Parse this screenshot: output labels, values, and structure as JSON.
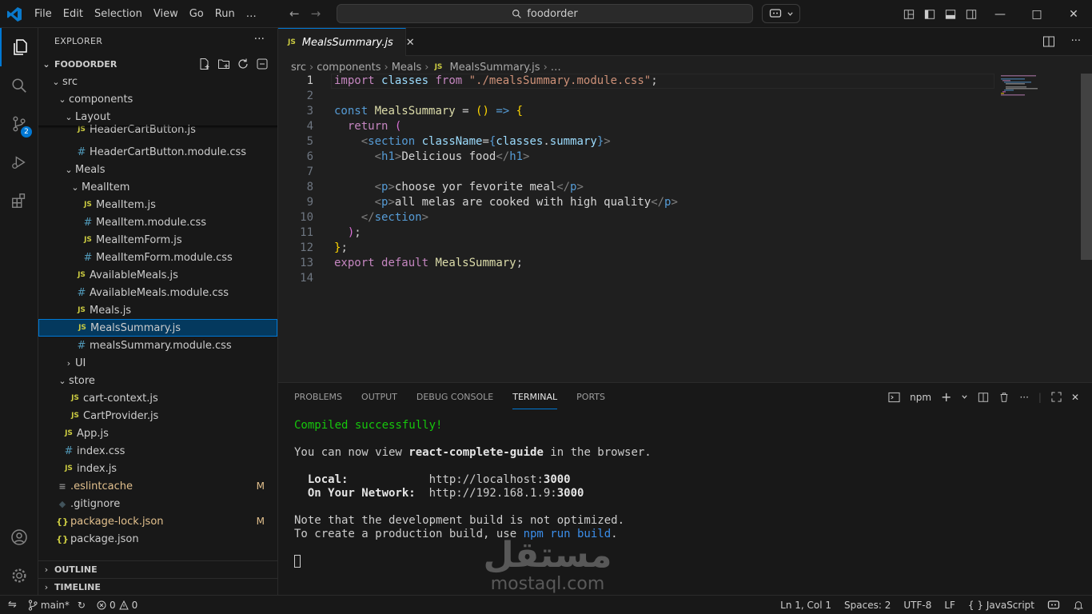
{
  "titlebar": {
    "menu": [
      "File",
      "Edit",
      "Selection",
      "View",
      "Go",
      "Run",
      "…"
    ],
    "search": "foodorder"
  },
  "activity": {
    "source_control_badge": "2"
  },
  "sidebar": {
    "title": "EXPLORER",
    "more": "···",
    "root": "FOODORDER",
    "tree": [
      {
        "label": "src",
        "icon": "folder-open"
      },
      {
        "label": "components",
        "icon": "folder-open"
      },
      {
        "label": "Layout",
        "icon": "folder-open"
      },
      {
        "label": "HeaderCartButton.js",
        "icon": "js"
      },
      {
        "label": "HeaderCartButton.module.css",
        "icon": "css"
      },
      {
        "label": "Meals",
        "icon": "folder-open"
      },
      {
        "label": "MealItem",
        "icon": "folder-open"
      },
      {
        "label": "MealItem.js",
        "icon": "js"
      },
      {
        "label": "MealItem.module.css",
        "icon": "css"
      },
      {
        "label": "MealItemForm.js",
        "icon": "js"
      },
      {
        "label": "MealItemForm.module.css",
        "icon": "css"
      },
      {
        "label": "AvailableMeals.js",
        "icon": "js"
      },
      {
        "label": "AvailableMeals.module.css",
        "icon": "css"
      },
      {
        "label": "Meals.js",
        "icon": "js"
      },
      {
        "label": "MealsSummary.js",
        "icon": "js"
      },
      {
        "label": "mealsSummary.module.css",
        "icon": "css"
      },
      {
        "label": "UI",
        "icon": "folder-closed"
      },
      {
        "label": "store",
        "icon": "folder-open"
      },
      {
        "label": "cart-context.js",
        "icon": "js"
      },
      {
        "label": "CartProvider.js",
        "icon": "js"
      },
      {
        "label": "App.js",
        "icon": "js"
      },
      {
        "label": "index.css",
        "icon": "css"
      },
      {
        "label": "index.js",
        "icon": "js"
      },
      {
        "label": ".eslintcache",
        "icon": "config",
        "status": "M"
      },
      {
        "label": ".gitignore",
        "icon": "git"
      },
      {
        "label": "package-lock.json",
        "icon": "json",
        "status": "M"
      },
      {
        "label": "package.json",
        "icon": "json"
      }
    ],
    "outline": "OUTLINE",
    "timeline": "TIMELINE"
  },
  "editor": {
    "tab": "MealsSummary.js",
    "breadcrumb": [
      "src",
      "components",
      "Meals",
      "MealsSummary.js",
      "…"
    ],
    "line_numbers": [
      "1",
      "2",
      "3",
      "4",
      "5",
      "6",
      "7",
      "8",
      "9",
      "10",
      "11",
      "12",
      "13",
      "14"
    ]
  },
  "panel": {
    "tabs": [
      "PROBLEMS",
      "OUTPUT",
      "DEBUG CONSOLE",
      "TERMINAL",
      "PORTS"
    ],
    "active_tab": "TERMINAL",
    "terminal_name": "npm",
    "output": {
      "compiled": "Compiled successfully!",
      "view_pre": "You can now view ",
      "app_name": "react-complete-guide",
      "view_post": " in the browser.",
      "local_label": "Local:",
      "local_url": "http://localhost:",
      "local_port": "3000",
      "network_label": "On Your Network:",
      "network_url": "http://192.168.1.9:",
      "network_port": "3000",
      "note": "Note that the development build is not optimized.",
      "prod_pre": "To create a production build, use ",
      "prod_cmd": "npm run build",
      "prod_post": "."
    },
    "watermark_ar": "مستقل",
    "watermark_en": "mostaql.com"
  },
  "statusbar": {
    "branch": "main*",
    "errors": "0",
    "warnings": "0",
    "position": "Ln 1, Col 1",
    "spaces": "Spaces: 2",
    "encoding": "UTF-8",
    "eol": "LF",
    "braces": "{ }",
    "language": "JavaScript"
  },
  "colors": {
    "accent": "#0078d4",
    "modified": "#e2c08d",
    "success": "#16c60c"
  }
}
